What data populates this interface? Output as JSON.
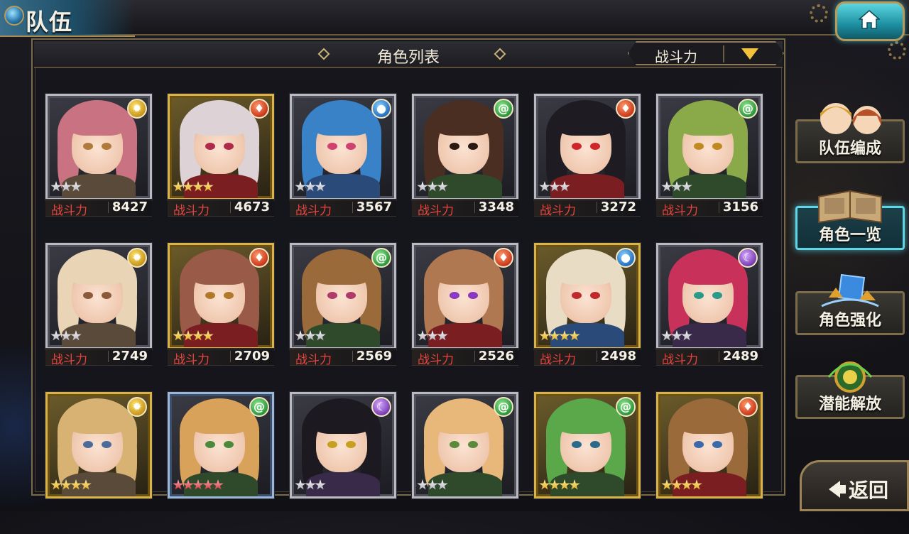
{
  "header": {
    "title": "队伍",
    "home_icon": "home-icon"
  },
  "panel": {
    "title": "角色列表",
    "sort_label": "战斗力"
  },
  "power_label": "战斗力",
  "cards": [
    {
      "power": "8427",
      "element": "sun",
      "rarity": 3,
      "hair": "#c97382",
      "eyes": "#b07a3a",
      "frame": "silver"
    },
    {
      "power": "4673",
      "element": "fire",
      "rarity": 4,
      "hair": "#ddd2d6",
      "eyes": "#b02a4a",
      "frame": "gold"
    },
    {
      "power": "3567",
      "element": "water",
      "rarity": 3,
      "hair": "#3a82c8",
      "eyes": "#d04070",
      "frame": "silver"
    },
    {
      "power": "3348",
      "element": "wind",
      "rarity": 3,
      "hair": "#4a2e22",
      "eyes": "#2a1a12",
      "frame": "silver"
    },
    {
      "power": "3272",
      "element": "fire",
      "rarity": 3,
      "hair": "#1e1c22",
      "eyes": "#d0262a",
      "frame": "silver"
    },
    {
      "power": "3156",
      "element": "wind",
      "rarity": 3,
      "hair": "#8aaa4a",
      "eyes": "#c08a20",
      "frame": "silver"
    },
    {
      "power": "2749",
      "element": "sun",
      "rarity": 3,
      "hair": "#e9d4b6",
      "eyes": "#8a5a3a",
      "frame": "silver"
    },
    {
      "power": "2709",
      "element": "fire",
      "rarity": 4,
      "hair": "#9a5a48",
      "eyes": "#b07a2a",
      "frame": "gold"
    },
    {
      "power": "2569",
      "element": "wind",
      "rarity": 3,
      "hair": "#9a6a3a",
      "eyes": "#b03a6a",
      "frame": "silver"
    },
    {
      "power": "2526",
      "element": "fire",
      "rarity": 3,
      "hair": "#b07850",
      "eyes": "#8a3ac0",
      "frame": "silver"
    },
    {
      "power": "2498",
      "element": "water",
      "rarity": 4,
      "hair": "#e9dcc4",
      "eyes": "#c02a2a",
      "frame": "gold"
    },
    {
      "power": "2489",
      "element": "moon",
      "rarity": 3,
      "hair": "#c8325a",
      "eyes": "#2a9a8a",
      "frame": "silver"
    },
    {
      "power": "",
      "element": "sun",
      "rarity": 4,
      "hair": "#d8b272",
      "eyes": "#4a6a9a",
      "frame": "gold"
    },
    {
      "power": "",
      "element": "wind",
      "rarity": 5,
      "hair": "#d8a25a",
      "eyes": "#4a8a3a",
      "frame": "blue"
    },
    {
      "power": "",
      "element": "moon",
      "rarity": 3,
      "hair": "#1c1a20",
      "eyes": "#c8a020",
      "frame": "silver"
    },
    {
      "power": "",
      "element": "wind",
      "rarity": 3,
      "hair": "#e8b87a",
      "eyes": "#5a8a3a",
      "frame": "silver"
    },
    {
      "power": "",
      "element": "wind",
      "rarity": 4,
      "hair": "#5aa84a",
      "eyes": "#2a6a8a",
      "frame": "gold"
    },
    {
      "power": "",
      "element": "fire",
      "rarity": 4,
      "hair": "#9a6a3a",
      "eyes": "#3a6aaa",
      "frame": "gold"
    }
  ],
  "side_menu": [
    {
      "label": "队伍编成",
      "active": false
    },
    {
      "label": "角色一览",
      "active": true
    },
    {
      "label": "角色强化",
      "active": false
    },
    {
      "label": "潜能解放",
      "active": false
    }
  ],
  "back_label": "返回",
  "colors": {
    "accent": "#5ed6e6",
    "gold": "#d8b24a",
    "power_label": "#e8443f"
  }
}
